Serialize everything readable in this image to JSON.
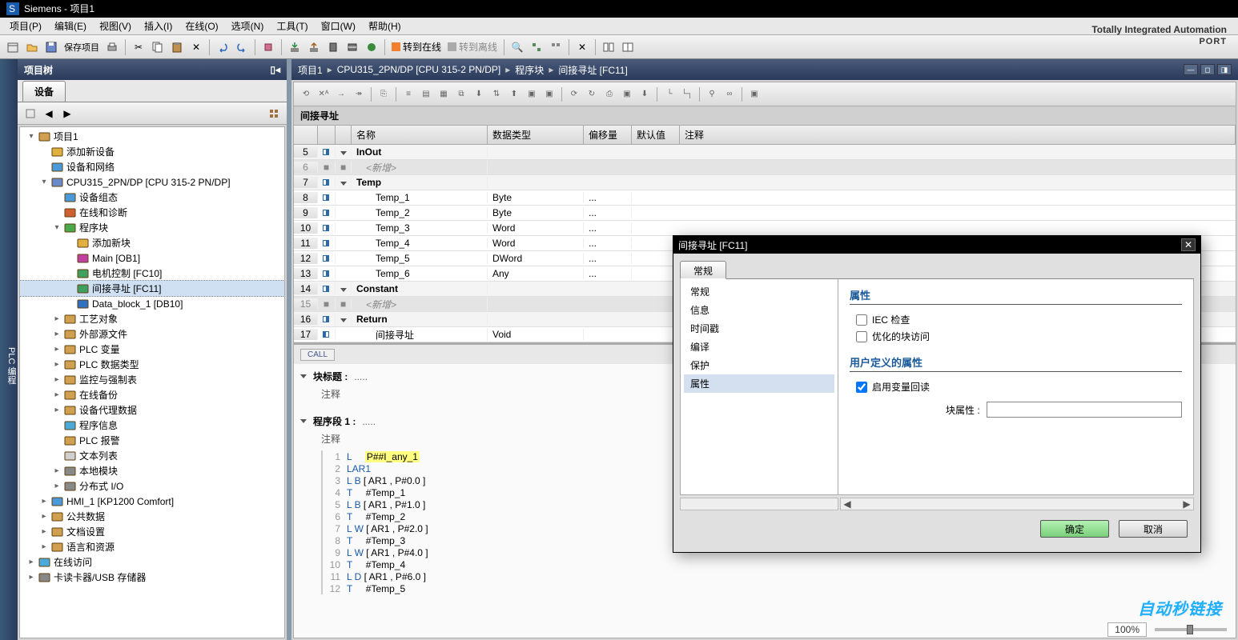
{
  "app": {
    "title": "Siemens - 项目1",
    "brand": "Totally Integrated Automation",
    "brand_sub": "PORT"
  },
  "menu": [
    "项目(P)",
    "编辑(E)",
    "视图(V)",
    "插入(I)",
    "在线(O)",
    "选项(N)",
    "工具(T)",
    "窗口(W)",
    "帮助(H)"
  ],
  "toolbar_labels": {
    "save_project": "保存项目",
    "go_online": "转到在线",
    "go_offline": "转到离线"
  },
  "left": {
    "panel": "项目树",
    "tab": "设备",
    "side_tab": "PLC 编程",
    "tree": [
      {
        "d": 0,
        "exp": "d",
        "ic": "proj",
        "t": "项目1"
      },
      {
        "d": 1,
        "exp": "",
        "ic": "add",
        "t": "添加新设备"
      },
      {
        "d": 1,
        "exp": "",
        "ic": "net",
        "t": "设备和网络"
      },
      {
        "d": 1,
        "exp": "d",
        "ic": "cpu",
        "t": "CPU315_2PN/DP [CPU 315-2 PN/DP]"
      },
      {
        "d": 2,
        "exp": "",
        "ic": "devcfg",
        "t": "设备组态"
      },
      {
        "d": 2,
        "exp": "",
        "ic": "diag",
        "t": "在线和诊断"
      },
      {
        "d": 2,
        "exp": "d",
        "ic": "folder-g",
        "t": "程序块"
      },
      {
        "d": 3,
        "exp": "",
        "ic": "add",
        "t": "添加新块"
      },
      {
        "d": 3,
        "exp": "",
        "ic": "ob",
        "t": "Main [OB1]"
      },
      {
        "d": 3,
        "exp": "",
        "ic": "fc",
        "t": "电机控制 [FC10]"
      },
      {
        "d": 3,
        "exp": "",
        "ic": "fc",
        "t": "间接寻址 [FC11]",
        "sel": true
      },
      {
        "d": 3,
        "exp": "",
        "ic": "db",
        "t": "Data_block_1 [DB10]"
      },
      {
        "d": 2,
        "exp": "r",
        "ic": "folder-t",
        "t": "工艺对象"
      },
      {
        "d": 2,
        "exp": "r",
        "ic": "folder",
        "t": "外部源文件"
      },
      {
        "d": 2,
        "exp": "r",
        "ic": "folder-t",
        "t": "PLC 变量"
      },
      {
        "d": 2,
        "exp": "r",
        "ic": "folder-t",
        "t": "PLC 数据类型"
      },
      {
        "d": 2,
        "exp": "r",
        "ic": "folder",
        "t": "监控与强制表"
      },
      {
        "d": 2,
        "exp": "r",
        "ic": "folder",
        "t": "在线备份"
      },
      {
        "d": 2,
        "exp": "r",
        "ic": "folder",
        "t": "设备代理数据"
      },
      {
        "d": 2,
        "exp": "",
        "ic": "info",
        "t": "程序信息"
      },
      {
        "d": 2,
        "exp": "",
        "ic": "alarm",
        "t": "PLC 报警"
      },
      {
        "d": 2,
        "exp": "",
        "ic": "txt",
        "t": "文本列表"
      },
      {
        "d": 2,
        "exp": "r",
        "ic": "mod",
        "t": "本地模块"
      },
      {
        "d": 2,
        "exp": "r",
        "ic": "io",
        "t": "分布式 I/O"
      },
      {
        "d": 1,
        "exp": "r",
        "ic": "hmi",
        "t": "HMI_1 [KP1200 Comfort]"
      },
      {
        "d": 1,
        "exp": "r",
        "ic": "folder",
        "t": "公共数据"
      },
      {
        "d": 1,
        "exp": "r",
        "ic": "folder",
        "t": "文档设置"
      },
      {
        "d": 1,
        "exp": "r",
        "ic": "folder",
        "t": "语言和资源"
      },
      {
        "d": 0,
        "exp": "r",
        "ic": "online",
        "t": "在线访问"
      },
      {
        "d": 0,
        "exp": "r",
        "ic": "card",
        "t": "卡读卡器/USB 存储器"
      }
    ]
  },
  "breadcrumb": [
    "项目1",
    "CPU315_2PN/DP [CPU 315-2 PN/DP]",
    "程序块",
    "间接寻址 [FC11]"
  ],
  "block_name": "间接寻址",
  "var_table": {
    "cols": [
      "名称",
      "数据类型",
      "偏移量",
      "默认值",
      "注释"
    ],
    "rows": [
      {
        "n": 5,
        "sect": true,
        "exp": "d",
        "pin": "l",
        "name": "InOut",
        "type": "",
        "off": "",
        "def": ""
      },
      {
        "n": 6,
        "dis": true,
        "pin": "",
        "name": "<新增>",
        "type": "",
        "off": "",
        "def": ""
      },
      {
        "n": 7,
        "sect": true,
        "exp": "d",
        "pin": "l",
        "name": "Temp",
        "type": "",
        "off": "",
        "def": ""
      },
      {
        "n": 8,
        "pin": "l",
        "name": "Temp_1",
        "type": "Byte",
        "off": "...",
        "def": ""
      },
      {
        "n": 9,
        "pin": "l",
        "name": "Temp_2",
        "type": "Byte",
        "off": "...",
        "def": ""
      },
      {
        "n": 10,
        "pin": "l",
        "name": "Temp_3",
        "type": "Word",
        "off": "...",
        "def": ""
      },
      {
        "n": 11,
        "pin": "l",
        "name": "Temp_4",
        "type": "Word",
        "off": "...",
        "def": ""
      },
      {
        "n": 12,
        "pin": "l",
        "name": "Temp_5",
        "type": "DWord",
        "off": "...",
        "def": ""
      },
      {
        "n": 13,
        "pin": "l",
        "name": "Temp_6",
        "type": "Any",
        "off": "...",
        "def": ""
      },
      {
        "n": 14,
        "sect": true,
        "exp": "d",
        "pin": "l",
        "name": "Constant",
        "type": "",
        "off": "",
        "def": ""
      },
      {
        "n": 15,
        "dis": true,
        "pin": "",
        "name": "<新增>",
        "type": "",
        "off": "",
        "def": ""
      },
      {
        "n": 16,
        "sect": true,
        "exp": "d",
        "pin": "l",
        "name": "Return",
        "type": "",
        "off": "",
        "def": ""
      },
      {
        "n": 17,
        "pin": "r",
        "name": "间接寻址",
        "type": "Void",
        "off": "",
        "def": ""
      }
    ]
  },
  "call_chip": "CALL",
  "segments": {
    "block_title": "块标题 :",
    "block_sub": "注释",
    "seg1_title": "程序段 1 :",
    "seg1_sub": "注释",
    "dots": "....."
  },
  "code": [
    {
      "n": 1,
      "html": "<span class='kw'>L</span>     <span class='tk-yellow'>P##I_any_1</span>"
    },
    {
      "n": 2,
      "html": "<span class='kw'>LAR1</span>"
    },
    {
      "n": 3,
      "html": "<span class='kw'>L</span> <span class='kw'>B</span> [ AR1 , P#0.0 ]"
    },
    {
      "n": 4,
      "html": "<span class='kw'>T</span>     #Temp_1"
    },
    {
      "n": 5,
      "html": "<span class='kw'>L</span> <span class='kw'>B</span> [ AR1 , P#1.0 ]"
    },
    {
      "n": 6,
      "html": "<span class='kw'>T</span>     #Temp_2"
    },
    {
      "n": 7,
      "html": "<span class='kw'>L</span> <span class='kw'>W</span> [ AR1 , P#2.0 ]"
    },
    {
      "n": 8,
      "html": "<span class='kw'>T</span>     #Temp_3"
    },
    {
      "n": 9,
      "html": "<span class='kw'>L</span> <span class='kw'>W</span> [ AR1 , P#4.0 ]"
    },
    {
      "n": 10,
      "html": "<span class='kw'>T</span>     #Temp_4"
    },
    {
      "n": 11,
      "html": "<span class='kw'>L</span> <span class='kw'>D</span> [ AR1 , P#6.0 ]"
    },
    {
      "n": 12,
      "html": "<span class='kw'>T</span>     #Temp_5"
    }
  ],
  "dialog": {
    "title": "间接寻址 [FC11]",
    "tab": "常规",
    "nav": [
      "常规",
      "信息",
      "时间戳",
      "编译",
      "保护",
      "属性"
    ],
    "nav_sel": 5,
    "h_attr": "属性",
    "cb_iec": "IEC 检查",
    "cb_opt": "优化的块访问",
    "h_user": "用户定义的属性",
    "cb_scan": "启用变量回读",
    "block_attr_label": "块属性 :",
    "ok": "确定",
    "cancel": "取消"
  },
  "status": {
    "zoom": "100%"
  },
  "watermark": "自动秒链接"
}
